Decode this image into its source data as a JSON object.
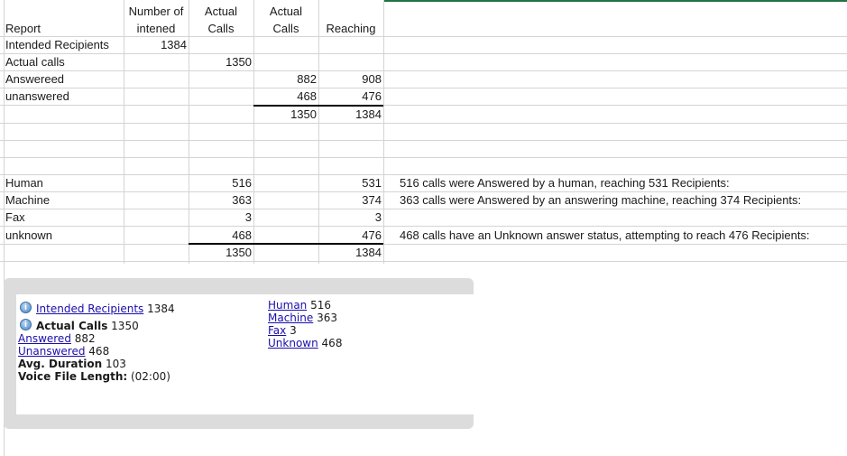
{
  "sheet": {
    "headers": {
      "col_b_line1": "Number of",
      "col_b_line2": "intened",
      "col_c_line1": "Actual",
      "col_c_line2": "Calls",
      "col_d_line1": "Actual",
      "col_d_line2": "Calls",
      "col_e": "Reaching"
    },
    "report_label": "Report",
    "rows_top": [
      {
        "label": "Intended Recipients",
        "b": "1384",
        "c": "",
        "d": "",
        "e": ""
      },
      {
        "label": "Actual calls",
        "b": "",
        "c": "1350",
        "d": "",
        "e": ""
      },
      {
        "label": "Answereed",
        "b": "",
        "c": "",
        "d": "882",
        "e": "908"
      },
      {
        "label": "unanswered",
        "b": "",
        "c": "",
        "d": "468",
        "e": "476"
      }
    ],
    "totals_top": {
      "d": "1350",
      "e": "1384"
    },
    "rows_bottom": [
      {
        "label": "Human",
        "c": "516",
        "e": "531",
        "note": "516 calls were Answered by a human, reaching 531 Recipients:"
      },
      {
        "label": "Machine",
        "c": "363",
        "e": "374",
        "note": "363 calls were Answered by an answering machine, reaching 374 Recipients:"
      },
      {
        "label": "Fax",
        "c": "3",
        "e": "3",
        "note": ""
      },
      {
        "label": "unknown",
        "c": "468",
        "e": "476",
        "note": "468 calls have an Unknown answer status, attempting to reach 476 Recipients:"
      }
    ],
    "totals_bottom": {
      "c": "1350",
      "e": "1384"
    }
  },
  "panel": {
    "intended_label": "Intended Recipients",
    "intended_value": "1384",
    "actual_label": "Actual Calls",
    "actual_value": "1350",
    "answered_label": "Answered",
    "answered_value": "882",
    "unanswered_label": "Unanswered",
    "unanswered_value": "468",
    "avg_label": "Avg. Duration",
    "avg_value": "103",
    "voice_label": "Voice File Length:",
    "voice_value": "(02:00)",
    "human_label": "Human",
    "human_value": "516",
    "machine_label": "Machine",
    "machine_value": "363",
    "fax_label": "Fax",
    "fax_value": "3",
    "unknown_label": "Unknown",
    "unknown_value": "468",
    "info_icon": "info-icon"
  }
}
